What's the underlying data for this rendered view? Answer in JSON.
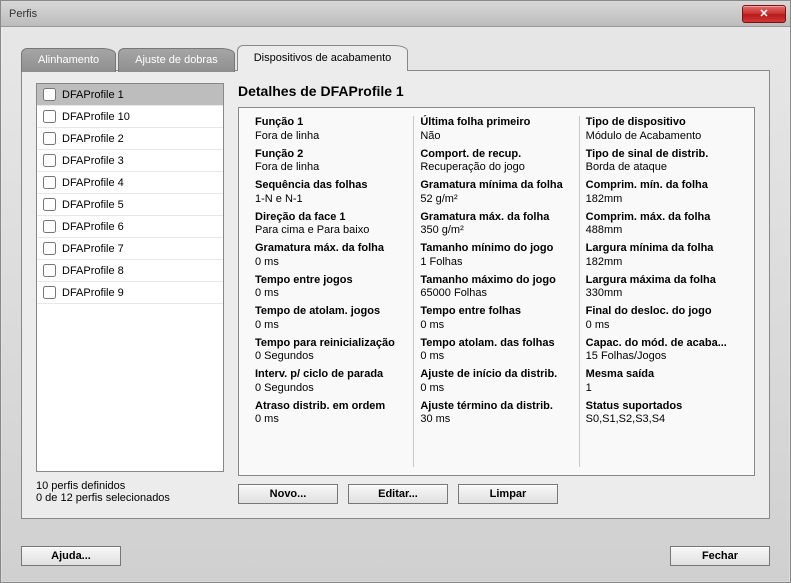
{
  "window": {
    "title": "Perfis"
  },
  "tabs": {
    "alignment": "Alinhamento",
    "fold_adjust": "Ajuste de dobras",
    "finishing": "Dispositivos de acabamento"
  },
  "profiles": [
    {
      "label": "DFAProfile 1",
      "selected": true
    },
    {
      "label": "DFAProfile 10"
    },
    {
      "label": "DFAProfile 2"
    },
    {
      "label": "DFAProfile 3"
    },
    {
      "label": "DFAProfile 4"
    },
    {
      "label": "DFAProfile 5"
    },
    {
      "label": "DFAProfile 6"
    },
    {
      "label": "DFAProfile 7"
    },
    {
      "label": "DFAProfile 8"
    },
    {
      "label": "DFAProfile 9"
    }
  ],
  "status": {
    "line1": "10 perfis definidos",
    "line2": "0 de 12 perfis selecionados"
  },
  "details": {
    "title": "Detalhes de DFAProfile 1",
    "col1": [
      {
        "label": "Função 1",
        "value": "Fora de linha"
      },
      {
        "label": "Função 2",
        "value": "Fora de linha"
      },
      {
        "label": "Sequência das folhas",
        "value": "1-N e N-1"
      },
      {
        "label": "Direção da face 1",
        "value": "Para cima e Para baixo"
      },
      {
        "label": "Gramatura máx. da folha",
        "value": "0 ms"
      },
      {
        "label": "Tempo entre jogos",
        "value": "0 ms"
      },
      {
        "label": "Tempo de atolam. jogos",
        "value": "0 ms"
      },
      {
        "label": "Tempo para reinicialização",
        "value": "0 Segundos"
      },
      {
        "label": "Interv. p/ ciclo de parada",
        "value": "0 Segundos"
      },
      {
        "label": "Atraso distrib. em ordem",
        "value": "0 ms"
      }
    ],
    "col2": [
      {
        "label": "Última folha primeiro",
        "value": "Não"
      },
      {
        "label": "Comport. de recup.",
        "value": "Recuperação do jogo"
      },
      {
        "label": "Gramatura mínima da folha",
        "value": "52 g/m²"
      },
      {
        "label": "Gramatura máx. da folha",
        "value": "350 g/m²"
      },
      {
        "label": "Tamanho mínimo do jogo",
        "value": "1 Folhas"
      },
      {
        "label": "Tamanho máximo do jogo",
        "value": "65000 Folhas"
      },
      {
        "label": "Tempo entre folhas",
        "value": "0 ms"
      },
      {
        "label": "Tempo atolam. das folhas",
        "value": "0 ms"
      },
      {
        "label": "Ajuste de início da distrib.",
        "value": "0 ms"
      },
      {
        "label": "Ajuste término da distrib.",
        "value": "30 ms"
      }
    ],
    "col3": [
      {
        "label": "Tipo de dispositivo",
        "value": "Módulo de Acabamento"
      },
      {
        "label": "Tipo de sinal de distrib.",
        "value": "Borda de ataque"
      },
      {
        "label": "Comprim. mín. da folha",
        "value": "182mm"
      },
      {
        "label": "Comprim. máx. da folha",
        "value": "488mm"
      },
      {
        "label": "Largura mínima da folha",
        "value": "182mm"
      },
      {
        "label": "Largura máxima da folha",
        "value": "330mm"
      },
      {
        "label": "Final do desloc. do jogo",
        "value": "0 ms"
      },
      {
        "label": "Capac. do mód. de acaba...",
        "value": "15 Folhas/Jogos"
      },
      {
        "label": "Mesma saída",
        "value": "1"
      },
      {
        "label": "Status suportados",
        "value": "S0,S1,S2,S3,S4"
      }
    ]
  },
  "buttons": {
    "new": "Novo...",
    "edit": "Editar...",
    "clear": "Limpar",
    "help": "Ajuda...",
    "close": "Fechar"
  }
}
